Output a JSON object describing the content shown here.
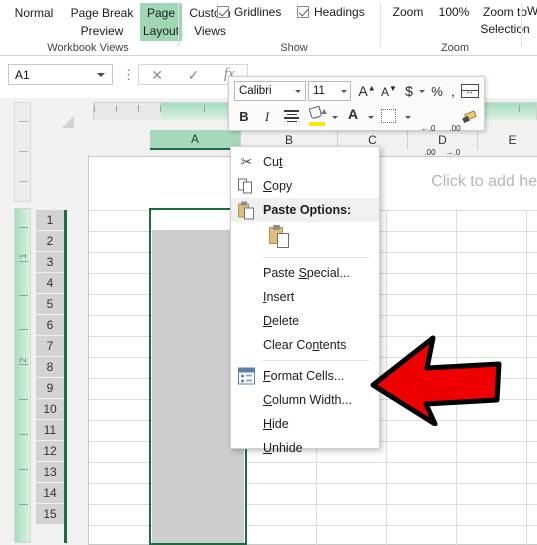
{
  "ribbon": {
    "groups": [
      {
        "name": "Workbook Views",
        "label": "Workbook Views"
      },
      {
        "name": "Show",
        "label": "Show"
      },
      {
        "name": "Zoom",
        "label": "Zoom"
      }
    ],
    "workbook_views": {
      "normal": "Normal",
      "page_break_preview_line1": "Page Break",
      "page_break_preview_line2": "Preview",
      "page_layout_line1": "Page",
      "page_layout_line2": "Layout",
      "custom_views_line1": "Custom",
      "custom_views_line2": "Views",
      "selected": "Page Layout",
      "group_label": "Workbook Views"
    },
    "show": {
      "gridlines_label": "Gridlines",
      "gridlines_checked": true,
      "headings_label": "Headings",
      "headings_checked": true,
      "group_label": "Show"
    },
    "zoom": {
      "zoom_label": "Zoom",
      "zoom_level": "100%",
      "zoom_to_selection_line1": "Zoom to",
      "zoom_to_selection_line2": "Selection",
      "group_label": "Zoom",
      "next_group_partial": "W"
    }
  },
  "formula_bar": {
    "name_box_value": "A1",
    "cancel_icon": "close-icon",
    "enter_icon": "check-icon",
    "function_icon": "fx",
    "function_label": "fx"
  },
  "mini_toolbar": {
    "font_name": "Calibri",
    "font_size": "11",
    "grow_font": "A",
    "shrink_font": "A",
    "accounting_format": "$",
    "percent_format": "%",
    "comma_format": ",",
    "merge_icon": "merge-cells-icon",
    "bold": "B",
    "italic": "I",
    "center_icon": "align-center-icon",
    "fill_color_icon": "fill-color-icon",
    "font_color": "A",
    "borders_icon": "borders-icon",
    "increase_decimal": ".00",
    "decrease_decimal": ".0",
    "format_painter_icon": "format-painter-icon"
  },
  "sheet": {
    "columns": [
      "A",
      "B",
      "C",
      "D",
      "E"
    ],
    "selected_column": "A",
    "rows": [
      "1",
      "2",
      "3",
      "4",
      "5",
      "6",
      "7",
      "8",
      "9",
      "10",
      "11",
      "12",
      "13",
      "14",
      "15"
    ],
    "active_cell": "A1",
    "header_placeholder": "Click to add he",
    "vruler_marks": [
      "1",
      "2"
    ]
  },
  "context_menu": {
    "items": [
      {
        "id": "cut",
        "label": "Cut",
        "accel_index": 2,
        "icon": "scissors-icon",
        "bold": false
      },
      {
        "id": "copy",
        "label": "Copy",
        "accel_index": 0,
        "icon": "copy-icon",
        "bold": false
      },
      {
        "id": "paste-options",
        "label": "Paste Options:",
        "accel_index": -1,
        "icon": "clipboard-icon",
        "bold": true
      },
      {
        "id": "paste-gallery",
        "label": "",
        "accel_index": -1,
        "icon": "clipboard-paste-icon",
        "bold": false
      },
      {
        "id": "paste-special",
        "label": "Paste Special...",
        "accel_index": 6,
        "icon": "",
        "bold": false
      },
      {
        "id": "insert",
        "label": "Insert",
        "accel_index": 0,
        "icon": "",
        "bold": false
      },
      {
        "id": "delete",
        "label": "Delete",
        "accel_index": 0,
        "icon": "",
        "bold": false
      },
      {
        "id": "clear-contents",
        "label": "Clear Contents",
        "accel_index": 8,
        "icon": "",
        "bold": false
      },
      {
        "id": "format-cells",
        "label": "Format Cells...",
        "accel_index": 0,
        "icon": "format-cells-icon",
        "bold": false
      },
      {
        "id": "column-width",
        "label": "Column Width...",
        "accel_index": 0,
        "icon": "",
        "bold": false
      },
      {
        "id": "hide",
        "label": "Hide",
        "accel_index": 0,
        "icon": "",
        "bold": false
      },
      {
        "id": "unhide",
        "label": "Unhide",
        "accel_index": 0,
        "icon": "",
        "bold": false
      }
    ]
  },
  "annotation": {
    "arrow_color": "#ee0000",
    "arrow_outline": "#000000",
    "arrow_direction": "left",
    "points_at": "Column Width..."
  },
  "colors": {
    "accent_green": "#1d6b3f",
    "selection_green": "#a5d9ba",
    "selected_cells": "#cdcdcd",
    "red": "#ee0000"
  }
}
